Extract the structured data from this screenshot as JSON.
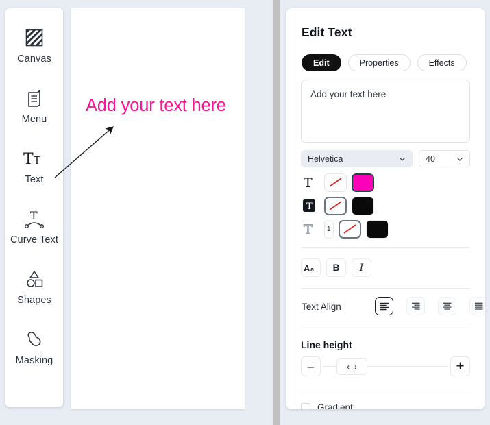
{
  "sidebar": {
    "items": [
      {
        "label": "Canvas",
        "icon": "canvas-hatched-square-icon"
      },
      {
        "label": "Menu",
        "icon": "menu-booklet-icon"
      },
      {
        "label": "Text",
        "icon": "text-tt-icon"
      },
      {
        "label": "Curve Text",
        "icon": "curve-text-icon"
      },
      {
        "label": "Shapes",
        "icon": "shapes-icon"
      },
      {
        "label": "Masking",
        "icon": "masking-blob-icon"
      }
    ]
  },
  "canvas": {
    "text": "Add your text here",
    "text_color": "#ff1593",
    "annotation_arrow": "arrow-pointing-to-text"
  },
  "panel": {
    "title": "Edit Text",
    "tabs": [
      {
        "label": "Edit",
        "active": true
      },
      {
        "label": "Properties",
        "active": false
      },
      {
        "label": "Effects",
        "active": false
      }
    ],
    "textarea": {
      "value": "Add your text here",
      "placeholder": "Add your text here"
    },
    "font": {
      "label": "Helvetica",
      "size": "40"
    },
    "color_rows": [
      {
        "name": "text-fill",
        "icon": "serif-t-icon",
        "none_selected": false,
        "color": "#ff00b8",
        "color_selected": true,
        "has_stroke_width": false,
        "stroke_width": ""
      },
      {
        "name": "text-highlight",
        "icon": "t-on-black-square-icon",
        "none_selected": true,
        "color": "#0a0a0a",
        "color_selected": false,
        "has_stroke_width": false,
        "stroke_width": ""
      },
      {
        "name": "text-outline",
        "icon": "outlined-t-icon",
        "none_selected": true,
        "color": "#0a0a0a",
        "color_selected": false,
        "has_stroke_width": true,
        "stroke_width": "1"
      }
    ],
    "style_buttons": [
      {
        "label": "Aa",
        "name": "case-button"
      },
      {
        "label": "B",
        "name": "bold-button"
      },
      {
        "label": "I",
        "name": "italic-button"
      }
    ],
    "text_align": {
      "label": "Text Align",
      "options": [
        {
          "name": "align-left-icon",
          "selected": true
        },
        {
          "name": "align-right-icon",
          "selected": false
        },
        {
          "name": "align-center-icon",
          "selected": false
        },
        {
          "name": "align-justify-icon",
          "selected": false
        }
      ]
    },
    "line_height": {
      "label": "Line height",
      "minus_label": "–",
      "plus_label": "+",
      "thumb_left_label": "‹",
      "thumb_right_label": "›"
    },
    "gradient": {
      "label": "Gradient:",
      "checked": false
    }
  },
  "colors": {
    "accent_pink": "#ff1593",
    "swatch_magenta": "#ff00b8",
    "swatch_black": "#0a0a0a",
    "tab_active_bg": "#111111",
    "page_bg": "#e8ecf3",
    "slash_red": "#e32020"
  }
}
